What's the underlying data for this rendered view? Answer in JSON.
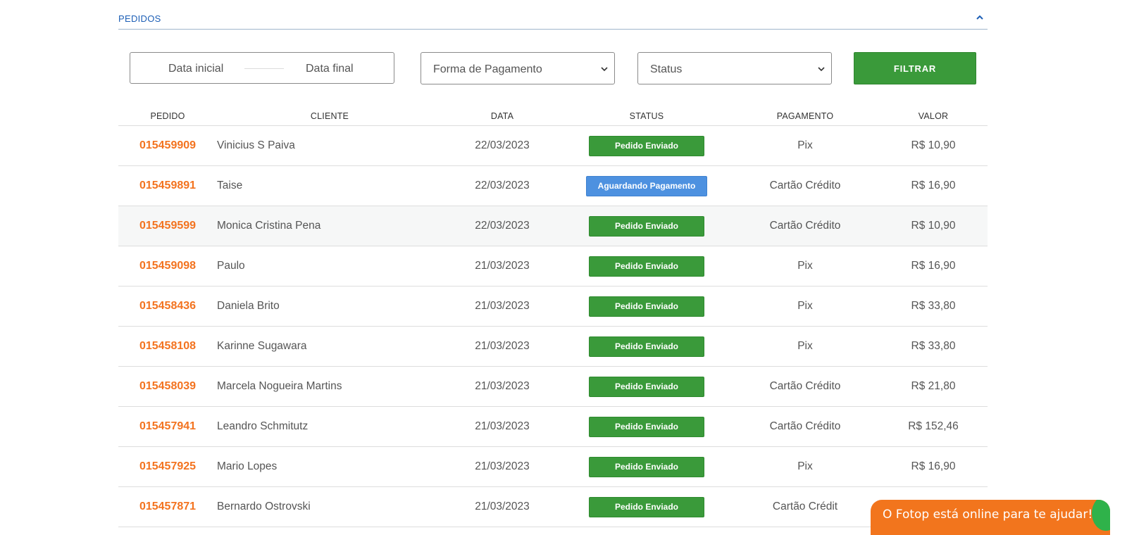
{
  "section": {
    "title": "PEDIDOS",
    "collapse_icon": "chevron-up-icon"
  },
  "filters": {
    "date_start_placeholder": "Data inicial",
    "date_end_placeholder": "Data final",
    "payment_select": "Forma de Pagamento",
    "status_select": "Status",
    "filter_button": "FILTRAR"
  },
  "table": {
    "headers": [
      "PEDIDO",
      "CLIENTE",
      "DATA",
      "STATUS",
      "PAGAMENTO",
      "VALOR"
    ],
    "rows": [
      {
        "id": "015459909",
        "client": "Vinicius S Paiva",
        "date": "22/03/2023",
        "status": "Pedido Enviado",
        "payment": "Pix",
        "value": "R$ 10,90"
      },
      {
        "id": "015459891",
        "client": "Taise",
        "date": "22/03/2023",
        "status": "Aguardando Pagamento",
        "payment": "Cartão Crédito",
        "value": "R$ 16,90"
      },
      {
        "id": "015459599",
        "client": "Monica Cristina Pena",
        "date": "22/03/2023",
        "status": "Pedido Enviado",
        "payment": "Cartão Crédito",
        "value": "R$ 10,90"
      },
      {
        "id": "015459098",
        "client": "Paulo",
        "date": "21/03/2023",
        "status": "Pedido Enviado",
        "payment": "Pix",
        "value": "R$ 16,90"
      },
      {
        "id": "015458436",
        "client": "Daniela Brito",
        "date": "21/03/2023",
        "status": "Pedido Enviado",
        "payment": "Pix",
        "value": "R$ 33,80"
      },
      {
        "id": "015458108",
        "client": "Karinne Sugawara",
        "date": "21/03/2023",
        "status": "Pedido Enviado",
        "payment": "Pix",
        "value": "R$ 33,80"
      },
      {
        "id": "015458039",
        "client": "Marcela Nogueira Martins",
        "date": "21/03/2023",
        "status": "Pedido Enviado",
        "payment": "Cartão Crédito",
        "value": "R$ 21,80"
      },
      {
        "id": "015457941",
        "client": "Leandro Schmitutz",
        "date": "21/03/2023",
        "status": "Pedido Enviado",
        "payment": "Cartão Crédito",
        "value": "R$ 152,46"
      },
      {
        "id": "015457925",
        "client": "Mario Lopes",
        "date": "21/03/2023",
        "status": "Pedido Enviado",
        "payment": "Pix",
        "value": "R$ 16,90"
      },
      {
        "id": "015457871",
        "client": "Bernardo Ostrovski",
        "date": "21/03/2023",
        "status": "Pedido Enviado",
        "payment": "Cartão Crédit",
        "value": ""
      }
    ]
  },
  "chat": {
    "text": "O Fotop está online para te ajudar!"
  },
  "colors": {
    "accent_orange": "#f3731f",
    "status_sent": "#3a9a3a",
    "status_waiting": "#4d91e0",
    "title_blue": "#1d5fb6"
  }
}
